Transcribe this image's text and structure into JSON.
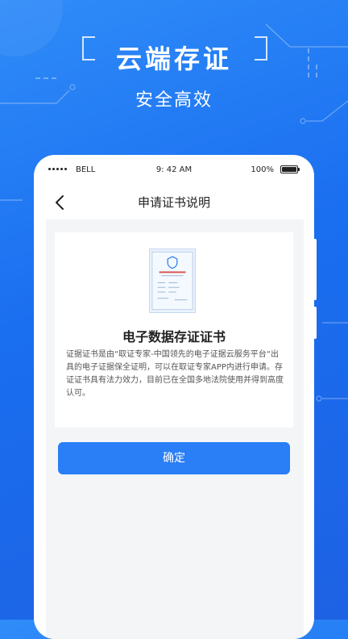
{
  "hero": {
    "title": "云端存证",
    "subtitle": "安全高效"
  },
  "status_bar": {
    "carrier": "BELL",
    "time": "9: 42 AM",
    "battery": "100%"
  },
  "nav": {
    "back_icon": "chevron-left-icon",
    "title": "申请证书说明"
  },
  "card": {
    "image_icon": "certificate-document",
    "title": "电子数据存证证书",
    "description": "证据证书是由“取证专家-中国领先的电子证据云服务平台“出具的电子证据保全证明，可以在取证专家APP内进行申请。存证证书具有法力效力，目前已在全国多地法院使用并得到高度认可。"
  },
  "confirm_button": {
    "label": "确定"
  },
  "colors": {
    "background": "#1a6ef0",
    "accent": "#2a7ef6"
  }
}
